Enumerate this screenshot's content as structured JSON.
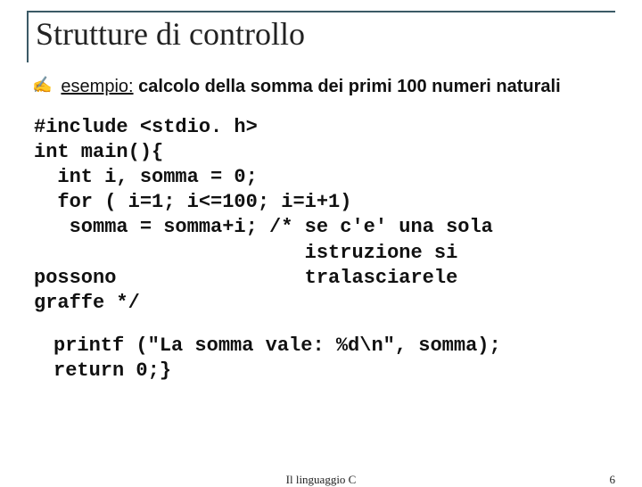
{
  "title": "Strutture di controllo",
  "bullet": {
    "icon": "✍",
    "word_underlined": "esempio:",
    "rest": " calcolo della somma dei primi 100 numeri naturali"
  },
  "code_block1": "#include <stdio. h>\nint main(){\n  int i, somma = 0;\n  for ( i=1; i<=100; i=i+1)\n   somma = somma+i; /* se c'e' una sola\n                       istruzione si\npossono                tralasciarele\ngraffe */",
  "code_block2": "printf (\"La somma vale: %d\\n\", somma);\nreturn 0;}",
  "footer_center": "Il linguaggio C",
  "footer_right": "6",
  "chart_data": {
    "type": "table",
    "title": "Slide code listing",
    "lines": [
      "#include <stdio. h>",
      "int main(){",
      "  int i, somma = 0;",
      "  for ( i=1; i<=100; i=i+1)",
      "   somma = somma+i; /* se c'e' una sola",
      "                       istruzione si",
      "possono                tralasciarele",
      "graffe */",
      "",
      "  printf (\"La somma vale: %d\\n\", somma);",
      "  return 0;}"
    ]
  }
}
